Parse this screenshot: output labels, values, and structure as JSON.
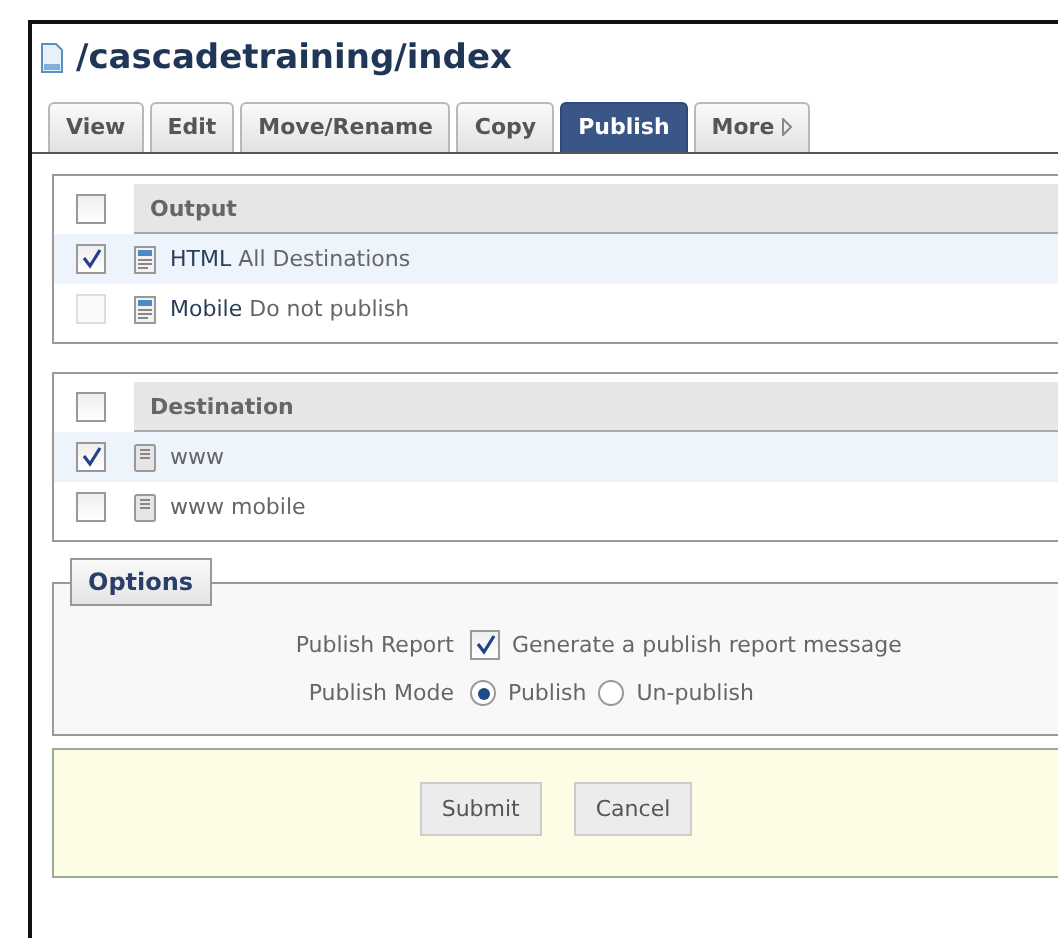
{
  "title": "/cascadetraining/index",
  "tabs": [
    {
      "label": "View",
      "selected": false
    },
    {
      "label": "Edit",
      "selected": false
    },
    {
      "label": "Move/Rename",
      "selected": false
    },
    {
      "label": "Copy",
      "selected": false
    },
    {
      "label": "Publish",
      "selected": true
    },
    {
      "label": "More",
      "selected": false,
      "kind": "menu"
    }
  ],
  "outputs": {
    "header": "Output",
    "all_checked": false,
    "rows": [
      {
        "name": "HTML",
        "detail": "All Destinations",
        "checked": true,
        "disabled": false
      },
      {
        "name": "Mobile",
        "detail": "Do not publish",
        "checked": false,
        "disabled": true
      }
    ]
  },
  "destinations": {
    "header": "Destination",
    "all_checked": false,
    "rows": [
      {
        "name": "www",
        "checked": true
      },
      {
        "name": "www mobile",
        "checked": false
      }
    ]
  },
  "options": {
    "legend": "Options",
    "report": {
      "label": "Publish Report",
      "checked": true,
      "text": "Generate a publish report message"
    },
    "mode": {
      "label": "Publish Mode",
      "choices": [
        {
          "label": "Publish",
          "selected": true
        },
        {
          "label": "Un-publish",
          "selected": false
        }
      ]
    }
  },
  "buttons": [
    "Submit",
    "Cancel"
  ]
}
